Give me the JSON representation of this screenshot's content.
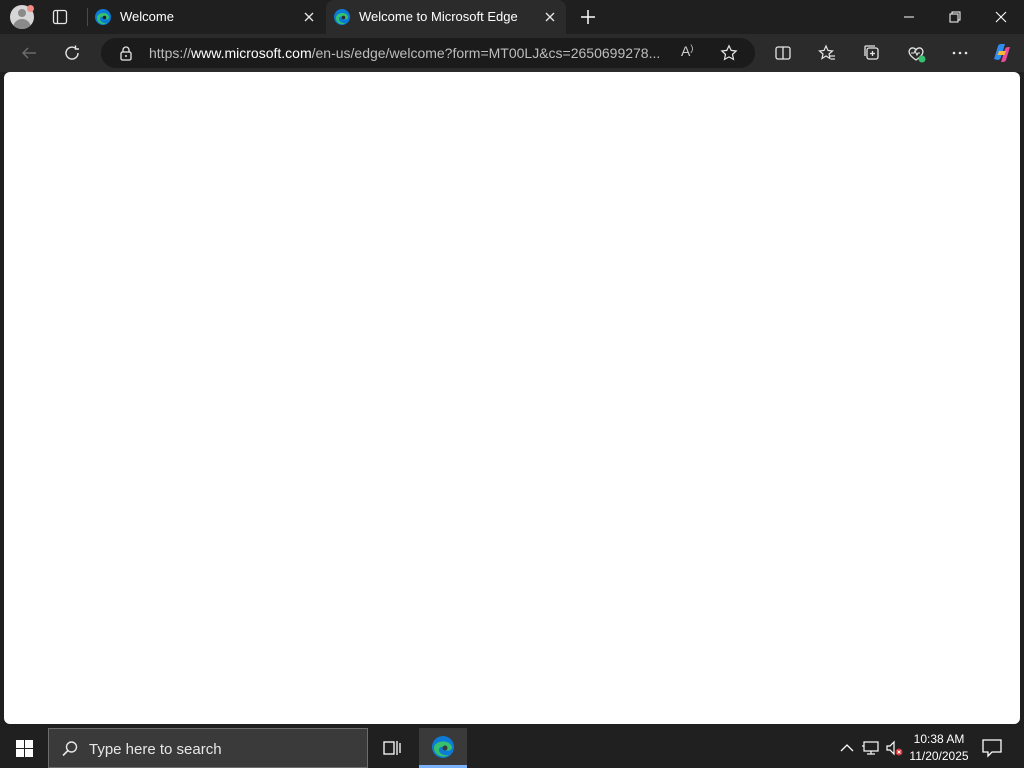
{
  "browser": {
    "tabs": [
      {
        "title": "Welcome",
        "active": false
      },
      {
        "title": "Welcome to Microsoft Edge",
        "active": true
      }
    ],
    "address": {
      "scheme": "https://",
      "host": "www.microsoft.com",
      "path": "/en-us/edge/welcome?form=MT00LJ&cs=2650699278...",
      "read_aloud_label": "A"
    }
  },
  "taskbar": {
    "search_placeholder": "Type here to search",
    "time": "10:38 AM",
    "date": "11/20/2025"
  },
  "colors": {
    "tabbar_bg": "#1f1f1f",
    "toolbar_bg": "#2b2b2b",
    "page_bg": "#ffffff",
    "taskbar_bg": "#202020",
    "edge_blue": "#0c7bd7",
    "edge_green": "#35c16f"
  },
  "icons": {
    "tab_bar": [
      "profile-avatar-icon",
      "tab-actions-icon",
      "edge-favicon-icon",
      "close-icon",
      "new-tab-plus-icon",
      "minimize-icon",
      "restore-icon",
      "window-close-icon"
    ],
    "toolbar": [
      "back-arrow-icon",
      "refresh-icon",
      "lock-icon",
      "read-aloud-icon",
      "favorite-star-icon",
      "split-screen-icon",
      "favorites-icon",
      "collections-icon",
      "browser-essentials-icon",
      "more-dots-icon",
      "copilot-icon"
    ],
    "taskbar": [
      "windows-start-icon",
      "search-magnifier-icon",
      "task-view-icon",
      "edge-taskbar-icon",
      "show-hidden-icons-chevron",
      "network-icon",
      "volume-muted-icon",
      "notifications-icon"
    ]
  }
}
